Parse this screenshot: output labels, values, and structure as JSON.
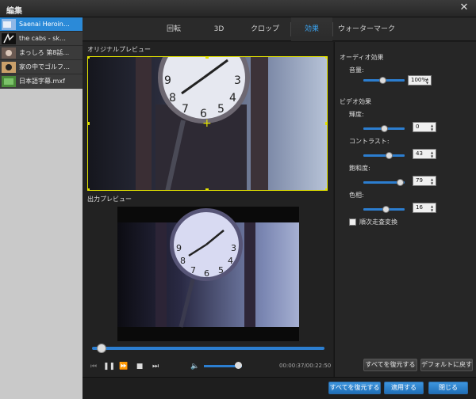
{
  "window": {
    "title": "編集"
  },
  "files": [
    {
      "label": "Saenai Heroin…",
      "selected": true
    },
    {
      "label": "the cabs - sk…",
      "selected": false
    },
    {
      "label": "まっしろ 第8話…",
      "selected": false
    },
    {
      "label": "家の中でゴルフ…",
      "selected": false
    },
    {
      "label": "日本語字幕.mxf",
      "selected": false
    }
  ],
  "tabs": [
    {
      "label": "回転"
    },
    {
      "label": "3D"
    },
    {
      "label": "クロップ"
    },
    {
      "label": "効果",
      "active": true
    },
    {
      "label": "ウォーターマーク"
    }
  ],
  "preview": {
    "original_label": "オリジナルプレビュー",
    "output_label": "出力プレビュー"
  },
  "player": {
    "time": "00:00:37/00:22:50",
    "progress": 0.02,
    "volume": 0.9
  },
  "audio": {
    "heading": "オーディオ効果",
    "volume_label": "音量:",
    "volume_value": "100%"
  },
  "video": {
    "heading": "ビデオ効果",
    "brightness_label": "輝度:",
    "brightness_value": "0",
    "contrast_label": "コントラスト:",
    "contrast_value": "43",
    "saturation_label": "飽和度:",
    "saturation_value": "79",
    "hue_label": "色相:",
    "hue_value": "16",
    "deinterlace_label": "順次走査変換"
  },
  "buttons": {
    "reset_all": "すべてを復元する",
    "default": "デフォルトに戻す",
    "restore_all": "すべてを復元する",
    "apply": "適用する",
    "close": "閉じる"
  },
  "colors": {
    "accent": "#2c7ed0",
    "crop_border": "#e5e500",
    "selected_item": "#2b8ad8"
  }
}
